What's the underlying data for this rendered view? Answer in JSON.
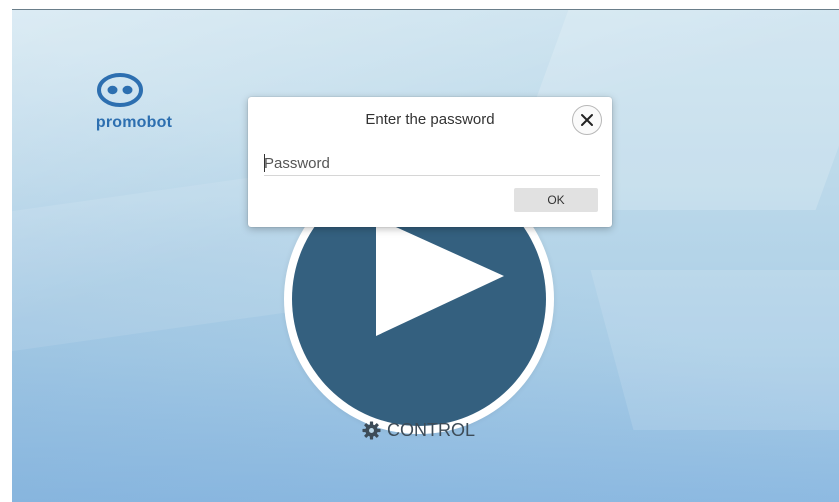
{
  "brand": {
    "name": "promobot",
    "color": "#2d6fb0"
  },
  "main": {
    "play_icon": "play-icon",
    "play_color": "#34607f",
    "control": {
      "icon": "gear-icon",
      "label": "CONTROL"
    }
  },
  "dialog": {
    "title": "Enter the password",
    "close_icon": "close-icon",
    "password": {
      "value": "",
      "placeholder": "Password"
    },
    "ok_label": "OK"
  }
}
